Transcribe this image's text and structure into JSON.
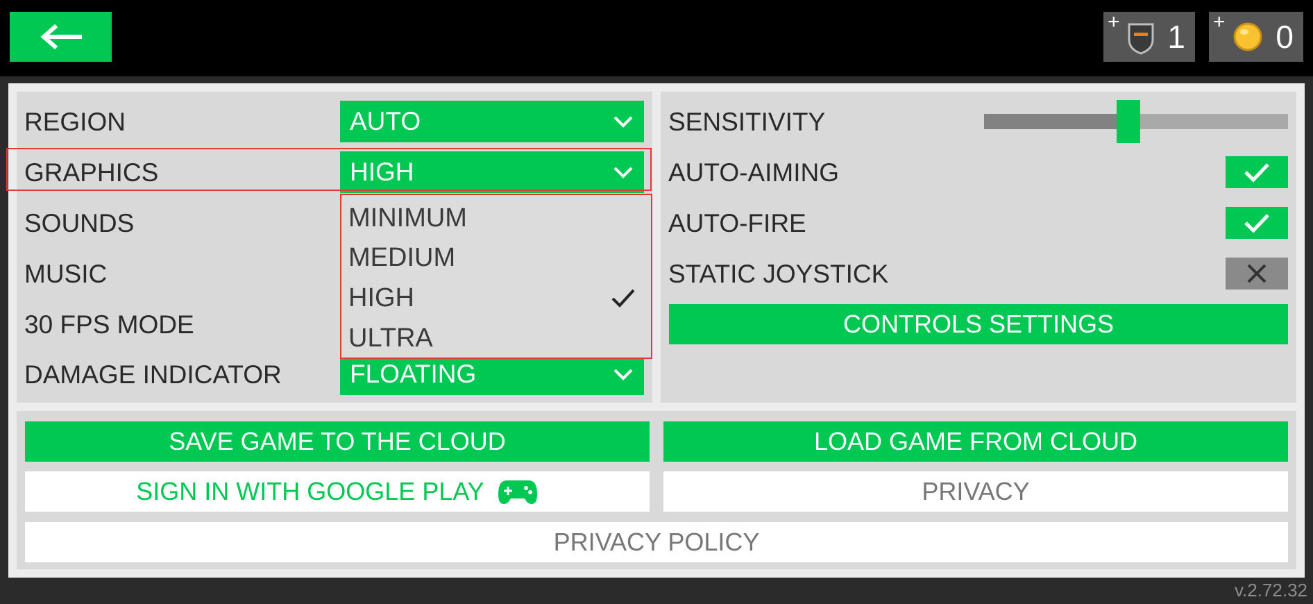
{
  "topbar": {
    "back_icon": "left-arrow-icon",
    "shield_plus": "+",
    "shield_count": "1",
    "coin_plus": "+",
    "coin_count": "0"
  },
  "left_settings": {
    "region": {
      "label": "REGION",
      "value": "AUTO"
    },
    "graphics": {
      "label": "GRAPHICS",
      "value": "HIGH"
    },
    "sounds": {
      "label": "SOUNDS"
    },
    "music": {
      "label": "MUSIC"
    },
    "fps": {
      "label": "30 FPS MODE"
    },
    "damage": {
      "label": "DAMAGE INDICATOR",
      "value": "FLOATING"
    }
  },
  "graphics_menu": {
    "options": [
      "MINIMUM",
      "MEDIUM",
      "HIGH",
      "ULTRA"
    ],
    "selected": "HIGH"
  },
  "right_settings": {
    "sensitivity": {
      "label": "SENSITIVITY",
      "level_percent": 50
    },
    "auto_aiming": {
      "label": "AUTO-AIMING",
      "checked": true
    },
    "auto_fire": {
      "label": "AUTO-FIRE",
      "checked": true
    },
    "static_joystick": {
      "label": "STATIC JOYSTICK",
      "checked": false
    },
    "controls_button": "CONTROLS SETTINGS"
  },
  "bottom": {
    "save_cloud": "SAVE GAME TO THE CLOUD",
    "load_cloud": "LOAD GAME FROM CLOUD",
    "google_signin": "SIGN IN WITH GOOGLE PLAY",
    "privacy": "PRIVACY",
    "privacy_policy": "PRIVACY POLICY"
  },
  "version": "v.2.72.32",
  "colors": {
    "accent": "#00c853",
    "highlight": "#e53935",
    "panel": "#d9d9d9"
  }
}
